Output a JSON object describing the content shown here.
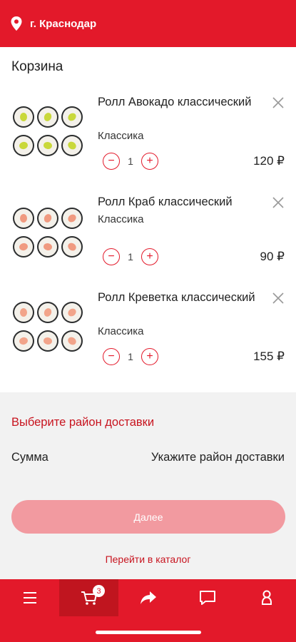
{
  "header": {
    "location": "г. Краснодар",
    "location_icon": "location-pin-icon"
  },
  "cart": {
    "title": "Корзина",
    "items": [
      {
        "name": "Ролл Авокадо классический",
        "category": "Классика",
        "quantity": "1",
        "price": "120 ₽",
        "filling": "#c9d83a"
      },
      {
        "name": "Ролл Краб классический",
        "category": "Классика",
        "quantity": "1",
        "price": "90 ₽",
        "filling": "#f09a80"
      },
      {
        "name": "Ролл Креветка классический",
        "category": "Классика",
        "quantity": "1",
        "price": "155 ₽",
        "filling": "#f2a48a"
      }
    ]
  },
  "delivery": {
    "choose_district": "Выберите район доставки"
  },
  "summary": {
    "label": "Сумма",
    "value": "Укажите район доставки"
  },
  "actions": {
    "next_label": "Далее",
    "catalog_link": "Перейти в каталог"
  },
  "bottom_nav": {
    "cart_badge": "3"
  },
  "colors": {
    "brand_red": "#e3192a",
    "disabled_button": "#f29aa0"
  }
}
